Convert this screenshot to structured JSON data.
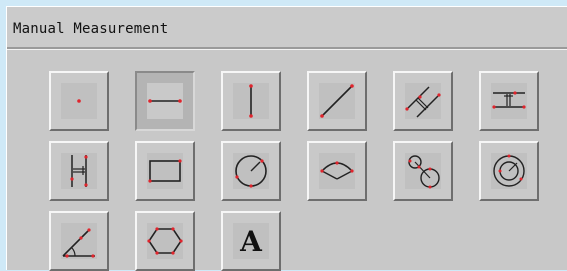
{
  "window": {
    "title": "Manual Measurement"
  },
  "tools": [
    {
      "icon": "point-icon",
      "state": "normal"
    },
    {
      "icon": "horizontal-line-icon",
      "state": "selected"
    },
    {
      "icon": "vertical-line-icon",
      "state": "normal"
    },
    {
      "icon": "diagonal-line-icon",
      "state": "normal"
    },
    {
      "icon": "parallel-lines-distance-icon",
      "state": "normal"
    },
    {
      "icon": "point-to-line-distance-icon",
      "state": "normal"
    },
    {
      "icon": "vertical-line-distance-icon",
      "state": "normal"
    },
    {
      "icon": "rectangle-icon",
      "state": "normal"
    },
    {
      "icon": "circle-radius-icon",
      "state": "normal"
    },
    {
      "icon": "arc-icon",
      "state": "normal"
    },
    {
      "icon": "two-circles-distance-icon",
      "state": "normal"
    },
    {
      "icon": "concentric-circles-icon",
      "state": "normal"
    },
    {
      "icon": "angle-icon",
      "state": "normal"
    },
    {
      "icon": "polygon-icon",
      "state": "normal"
    },
    {
      "icon": "text-annotation-icon",
      "state": "normal",
      "glyph": "A"
    }
  ],
  "colors": {
    "point": "#e0242c",
    "stroke": "#222222"
  }
}
